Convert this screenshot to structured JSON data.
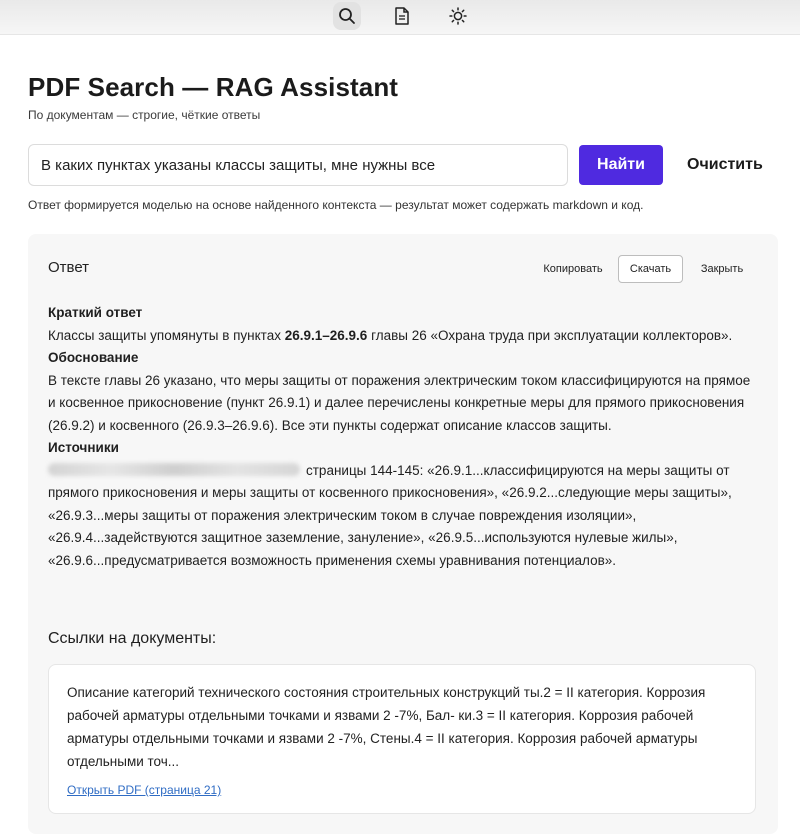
{
  "toolbar": {
    "icons": [
      "search-icon",
      "document-icon",
      "sun-icon"
    ]
  },
  "header": {
    "title": "PDF Search — RAG Assistant",
    "subtitle": "По документам — строгие, чёткие ответы"
  },
  "search": {
    "value": "В каких пунктах указаны классы защиты, мне нужны все",
    "submit_label": "Найти",
    "clear_label": "Очистить",
    "hint": "Ответ формируется моделью на основе найденного контекста — результат может содержать markdown и код."
  },
  "answer": {
    "title": "Ответ",
    "copy_label": "Копировать",
    "download_label": "Скачать",
    "close_label": "Закрыть",
    "summary_heading": "Краткий ответ",
    "summary_pre": "Классы защиты упомянуты в пунктах ",
    "summary_bold": "26.9.1–26.9.6",
    "summary_post": " главы 26 «Охрана труда при эксплуатации коллекторов».",
    "reason_heading": "Обоснование",
    "reason_text": "В тексте главы 26 указано, что меры защиты от поражения электрическим током классифицируются на прямое и косвенное прикосновение (пункт 26.9.1) и далее перечислены конкретные меры для прямого прикосновения (26.9.2) и косвенного (26.9.3–26.9.6). Все эти пункты содержат описание классов защиты.",
    "sources_heading": "Источники",
    "sources_text": "страницы 144-145: «26.9.1...классифицируются на меры защиты от прямого прикосновения и меры защиты от косвенного прикосновения», «26.9.2...следующие меры защиты», «26.9.3...меры защиты от поражения электрическим током в случае повреждения изоляции», «26.9.4...задействуются защитное заземление, зануление», «26.9.5...используются нулевые жилы», «26.9.6...предусматривается возможность применения схемы уравнивания потенциалов»."
  },
  "references": {
    "title": "Ссылки на документы:",
    "items": [
      {
        "text": "Описание категорий технического состояния строительных конструкций ты.2 = II категория. Коррозия рабочей арматуры отдельными точками и язвами 2 -7%, Бал- ки.3 = II категория. Коррозия рабочей арматуры отдельными точками и язвами 2 -7%, Стены.4 = II категория. Коррозия рабочей арматуры отдельными точ...",
        "link_label": "Открыть PDF (страница 21)"
      }
    ]
  }
}
